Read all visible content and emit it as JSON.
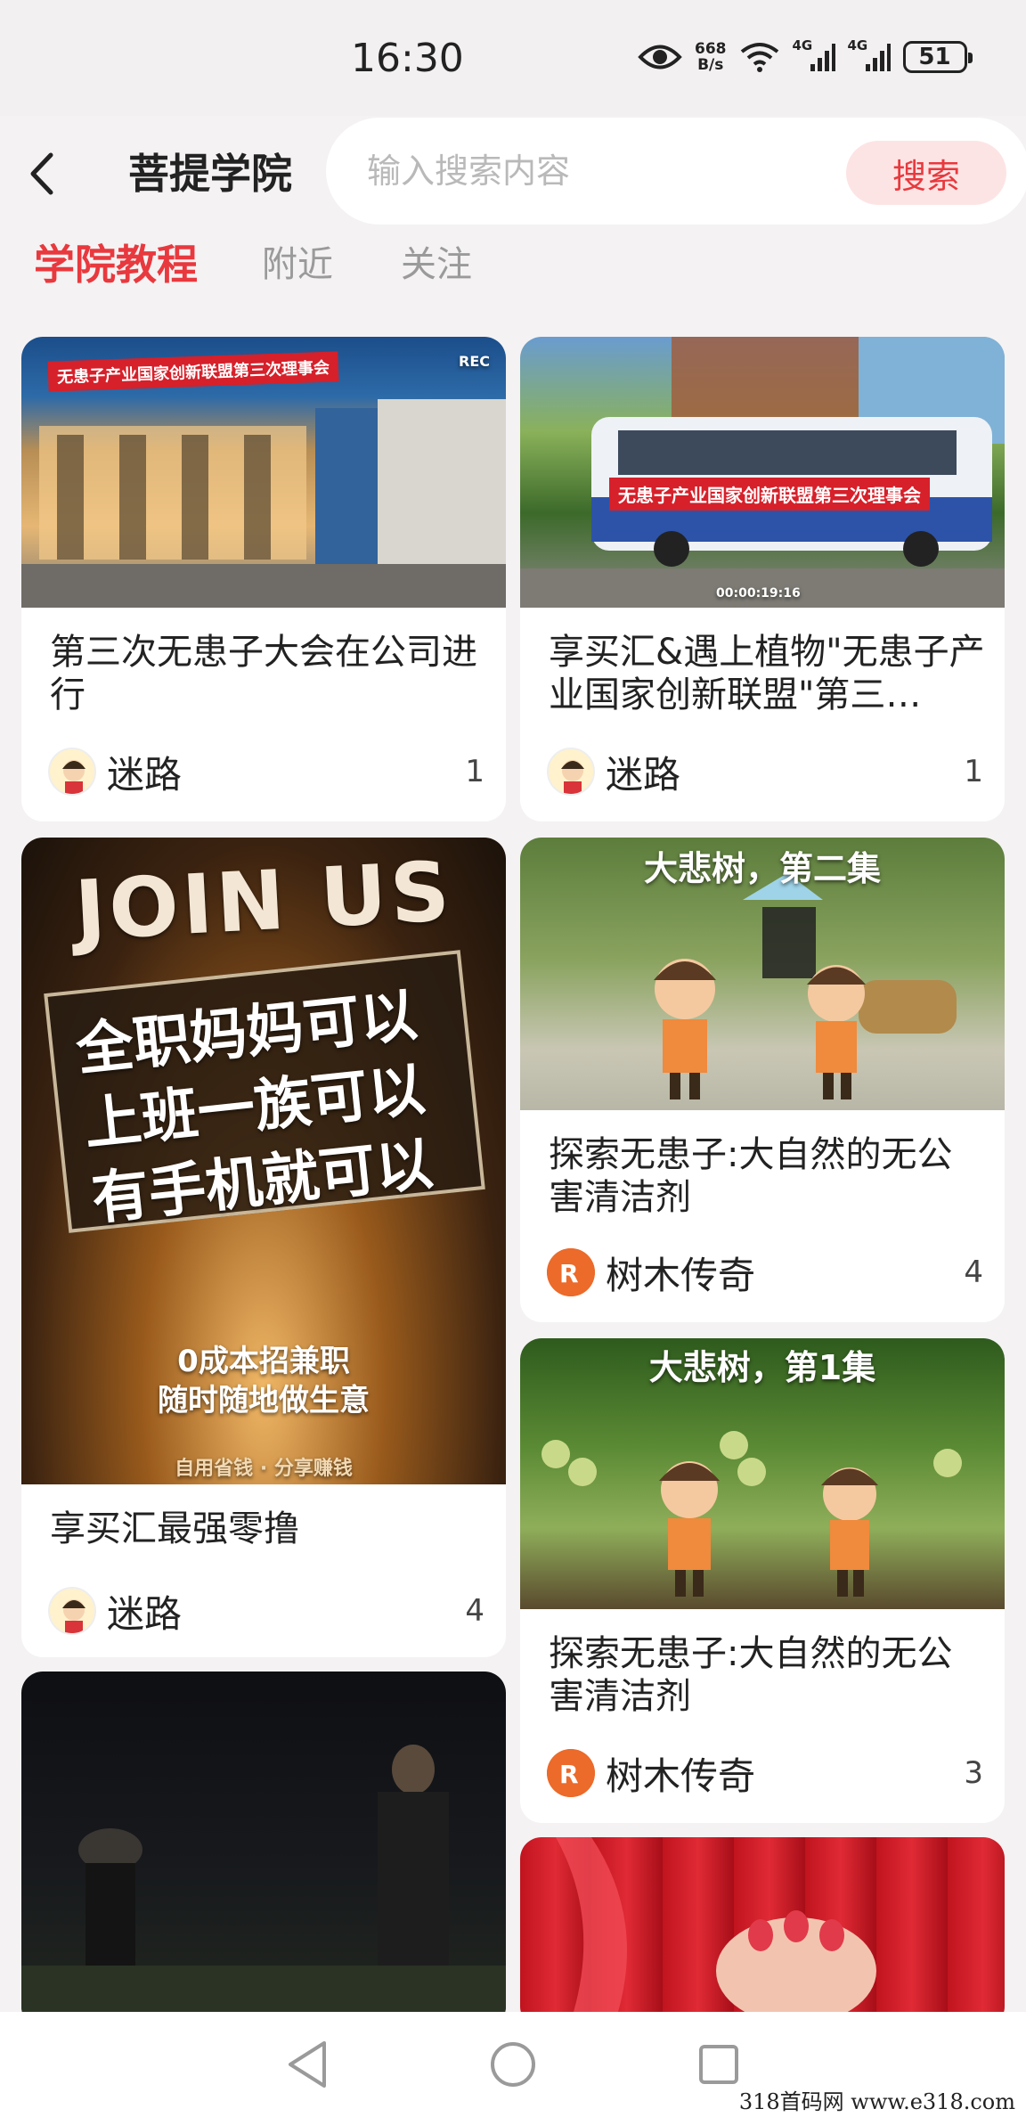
{
  "status_bar": {
    "time": "16:30",
    "net_speed_value": "668",
    "net_speed_unit": "B/s",
    "signal_1_label": "4G",
    "signal_2_label": "4G",
    "battery": "51"
  },
  "header": {
    "title": "菩提学院",
    "search_placeholder": "输入搜索内容",
    "search_button": "搜索"
  },
  "tabs": [
    {
      "label": "学院教程",
      "active": true
    },
    {
      "label": "附近",
      "active": false
    },
    {
      "label": "关注",
      "active": false
    }
  ],
  "feed": {
    "left": [
      {
        "title": "第三次无患子大会在公司进行",
        "author": "迷路",
        "count": "1",
        "image_banner": "无患子产业国家创新联盟第三次理事会",
        "image_overlay": "REC"
      },
      {
        "title": "享买汇最强零撸",
        "author": "迷路",
        "count": "4",
        "image_text_1": "JOIN US",
        "image_text_2": "全职妈妈可以",
        "image_text_3": "上班一族可以",
        "image_text_4": "有手机就可以",
        "image_text_5": "0成本招兼职",
        "image_text_6": "随时随地做生意",
        "image_text_7": "自用省钱 · 分享赚钱"
      },
      {
        "title": "",
        "author": "",
        "count": ""
      }
    ],
    "right": [
      {
        "title": "享买汇&遇上植物\"无患子产业国家创新联盟\"第三…",
        "author": "迷路",
        "count": "1",
        "image_banner": "无患子产业国家创新联盟第三次理事会",
        "image_overlay": "00:00:19:16"
      },
      {
        "title": "探索无患子:大自然的无公害清洁剂",
        "author": "树木传奇",
        "count": "4",
        "image_overlay": "大悲树，第二集"
      },
      {
        "title": "探索无患子:大自然的无公害清洁剂",
        "author": "树木传奇",
        "count": "3",
        "image_overlay": "大悲树，第1集"
      },
      {
        "title": "",
        "author": "",
        "count": ""
      }
    ]
  },
  "watermark": "318首码网  www.e318.com",
  "colors": {
    "accent": "#e8393e",
    "search_button_bg": "#fde4e4",
    "background": "#f4f2f3"
  },
  "icons": [
    "back-arrow-icon",
    "eye-icon",
    "wifi-icon",
    "signal-icon",
    "battery-icon",
    "nav-back-icon",
    "nav-home-icon",
    "nav-recents-icon"
  ]
}
